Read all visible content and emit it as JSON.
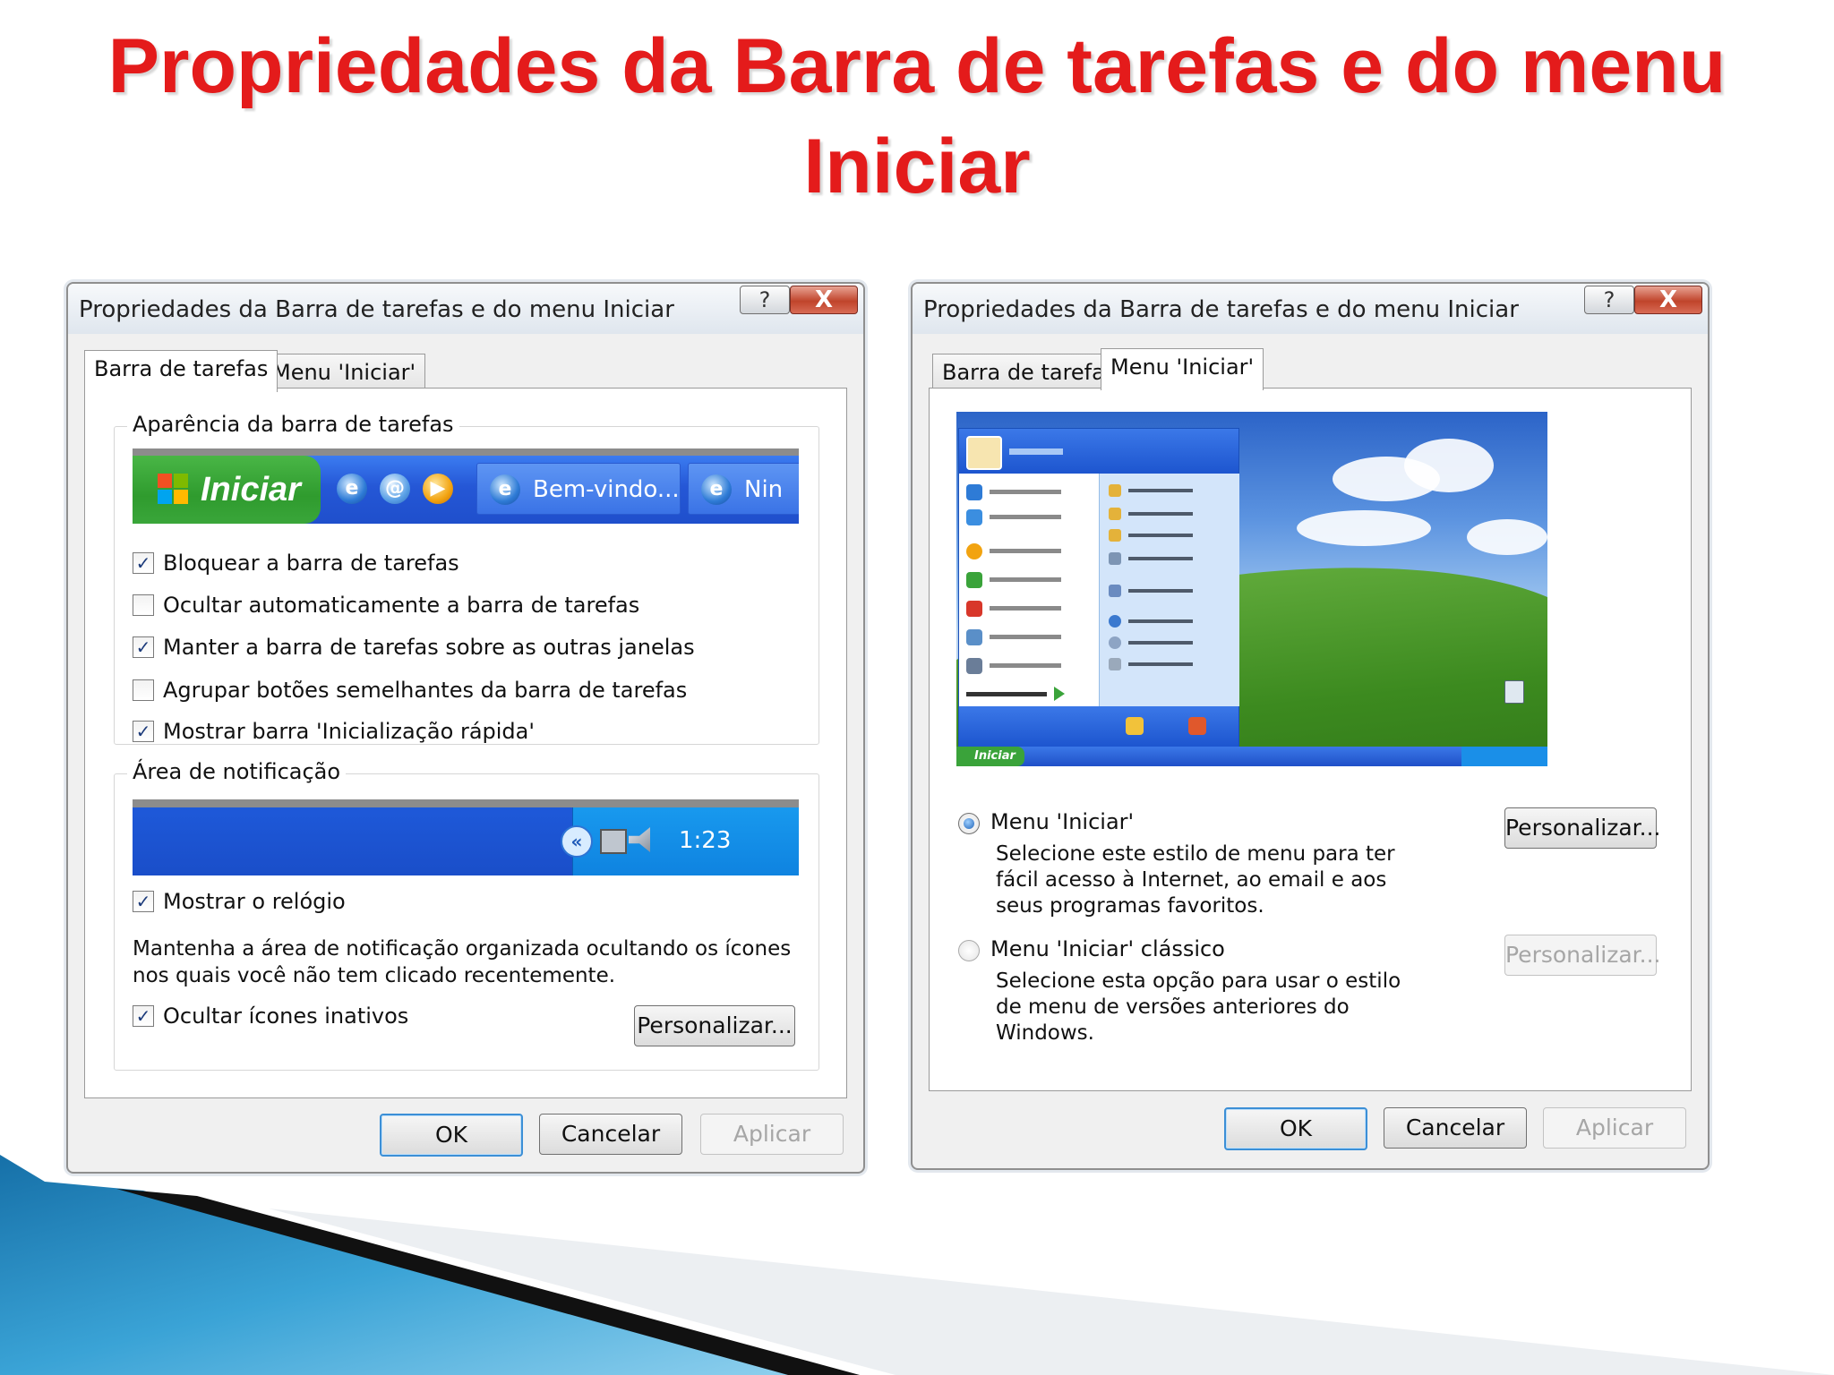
{
  "slide": {
    "title_line1": "Propriedades da Barra de tarefas e do menu",
    "title_line2": "Iniciar"
  },
  "window_title": "Propriedades da Barra de tarefas e do menu Iniciar",
  "caption_buttons": {
    "help": "?",
    "close": "X"
  },
  "tabs": {
    "taskbar": "Barra de tarefas",
    "start_menu": "Menu 'Iniciar'"
  },
  "dialog_taskbar": {
    "active_tab": "taskbar",
    "appearance_group": {
      "label": "Aparência da barra de tarefas",
      "preview": {
        "start_label": "Iniciar",
        "task_button_1": "Bem-vindo...",
        "task_button_2": "Nin"
      },
      "checkboxes": [
        {
          "label": "Bloquear a barra de tarefas",
          "checked": true,
          "mark": "✓"
        },
        {
          "label": "Ocultar automaticamente a barra de tarefas",
          "checked": false,
          "mark": ""
        },
        {
          "label": "Manter a barra de tarefas sobre as outras janelas",
          "checked": true,
          "mark": "✓"
        },
        {
          "label": "Agrupar botões semelhantes da barra de tarefas",
          "checked": false,
          "mark": ""
        },
        {
          "label": "Mostrar barra 'Inicialização rápida'",
          "checked": true,
          "mark": "✓"
        }
      ]
    },
    "notification_group": {
      "label": "Área de notificação",
      "clock": "1:23",
      "show_clock": {
        "label": "Mostrar o relógio",
        "checked": true,
        "mark": "✓"
      },
      "description": "Mantenha a área de notificação organizada ocultando os ícones nos quais você não tem clicado recentemente.",
      "hide_inactive": {
        "label": "Ocultar ícones inativos",
        "checked": true,
        "mark": "✓"
      },
      "customize_button": "Personalizar..."
    }
  },
  "dialog_start_menu": {
    "active_tab": "start_menu",
    "preview": {
      "taskbar_start_label": "Iniciar"
    },
    "options": [
      {
        "label": "Menu 'Iniciar'",
        "selected": true,
        "description": "Selecione este estilo de menu para ter fácil acesso à Internet, ao email e aos seus programas favoritos.",
        "button": "Personalizar...",
        "button_enabled": true
      },
      {
        "label": "Menu 'Iniciar' clássico",
        "selected": false,
        "description": "Selecione esta opção para usar o estilo de menu de versões anteriores do Windows.",
        "button": "Personalizar...",
        "button_enabled": false
      }
    ]
  },
  "buttons": {
    "ok": "OK",
    "cancel": "Cancelar",
    "apply": "Aplicar"
  },
  "colors": {
    "title_red": "#e41b1b",
    "xp_blue": "#2557d6",
    "xp_green": "#2f9b2e",
    "deco_teal": "#1f86c2"
  },
  "icons": {
    "quick_launch": [
      "internet-explorer-icon",
      "outlook-express-icon",
      "media-player-icon"
    ],
    "tray": [
      "show-hidden-icons-chevron-icon",
      "network-icon",
      "volume-icon"
    ]
  }
}
